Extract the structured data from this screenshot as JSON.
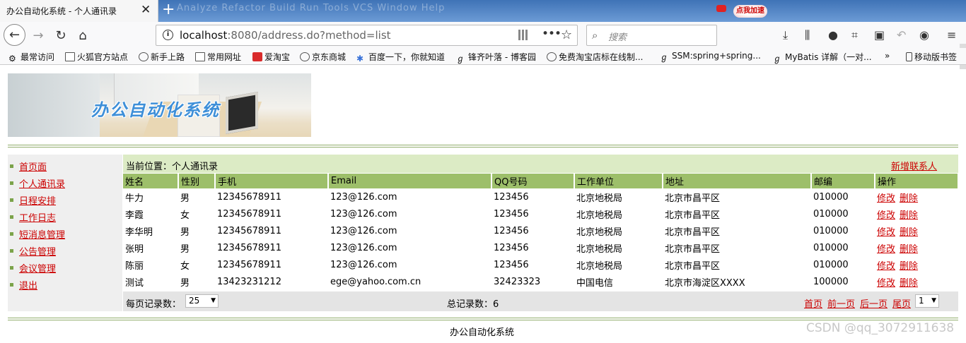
{
  "browser": {
    "tab_title": "办公自动化系统 - 个人通讯录",
    "tab_close": "✕",
    "new_tab": "+",
    "background_menu": "Analyze   Refactor   Build   Run   Tools   VCS   Window   Help",
    "ad_text": "点我加速",
    "url_host": "localhost",
    "url_rest": ":8080/address.do?method=list",
    "search_placeholder": "搜索",
    "bookmarks": [
      "最常访问",
      "火狐官方站点",
      "新手上路",
      "常用网址",
      "爱淘宝",
      "京东商城",
      "百度一下，你就知道",
      "锋齐叶落 - 博客园",
      "免费淘宝店标在线制...",
      "SSM:spring+spring...",
      "MyBatis 详解（一对...",
      "»",
      "移动版书签"
    ]
  },
  "banner": {
    "logo_text": "办公自动化系统"
  },
  "sidebar": {
    "items": [
      "首页面",
      "个人通讯录",
      "日程安排",
      "工作日志",
      "短消息管理",
      "公告管理",
      "会议管理",
      "退出"
    ]
  },
  "main": {
    "breadcrumb": "当前位置：个人通讯录",
    "add_contact": "新增联系人",
    "columns": [
      "姓名",
      "性别",
      "手机",
      "Email",
      "QQ号码",
      "工作单位",
      "地址",
      "邮编",
      "操作"
    ],
    "rows": [
      [
        "牛力",
        "男",
        "12345678911",
        "123@126.com",
        "123456",
        "北京地税局",
        "北京市昌平区",
        "010000"
      ],
      [
        "李霞",
        "女",
        "12345678911",
        "123@126.com",
        "123456",
        "北京地税局",
        "北京市昌平区",
        "010000"
      ],
      [
        "李华明",
        "男",
        "12345678911",
        "123@126.com",
        "123456",
        "北京地税局",
        "北京市昌平区",
        "010000"
      ],
      [
        "张明",
        "男",
        "12345678911",
        "123@126.com",
        "123456",
        "北京地税局",
        "北京市昌平区",
        "010000"
      ],
      [
        "陈丽",
        "女",
        "12345678911",
        "123@126.com",
        "123456",
        "北京地税局",
        "北京市昌平区",
        "010000"
      ],
      [
        "测试",
        "男",
        "13423231212",
        "ege@yahoo.com.cn",
        "32423323",
        "中国电信",
        "北京市海淀区XXXX",
        "100000"
      ]
    ],
    "edit_label": "修改",
    "delete_label": "删除",
    "pager": {
      "per_page_label": "每页记录数：",
      "per_page_value": "25",
      "total_label": "总记录数：6",
      "first": "首页",
      "prev": "前一页",
      "next": "后一页",
      "last": "尾页",
      "page_value": "1"
    }
  },
  "footer": {
    "text": "办公自动化系统",
    "watermark": "CSDN @qq_3072911638"
  },
  "colors": {
    "accent_green": "#9dbf6a",
    "link_red": "#cc0000",
    "crumb_bg": "#dcebc5"
  }
}
